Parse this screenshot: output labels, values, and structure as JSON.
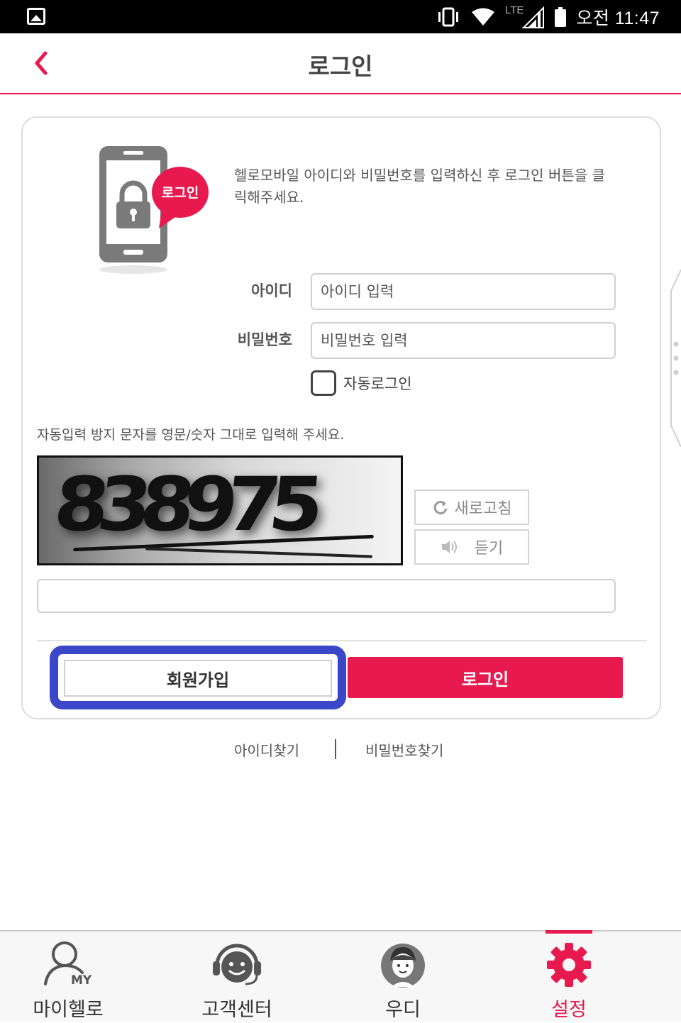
{
  "status_bar": {
    "time": "오전 11:47",
    "network": "LTE"
  },
  "header": {
    "title": "로그인"
  },
  "login": {
    "illustration_badge": "로그인",
    "intro": "헬로모바일 아이디와 비밀번호를 입력하신 후 로그인 버튼을 클릭해주세요.",
    "id_label": "아이디",
    "id_placeholder": "아이디 입력",
    "pw_label": "비밀번호",
    "pw_placeholder": "비밀번호 입력",
    "auto_login_label": "자동로그인",
    "captcha_guide": "자동입력 방지 문자를 영문/숫자 그대로 입력해 주세요.",
    "captcha_code": "838975",
    "refresh_label": "새로고침",
    "listen_label": "듣기",
    "join_label": "회원가입",
    "login_label": "로그인"
  },
  "find_links": {
    "find_id": "아이디찾기",
    "find_pw": "비밀번호찾기"
  },
  "bottom_nav": {
    "items": [
      {
        "label": "마이헬로",
        "icon": "my-person-icon",
        "badge": "MY"
      },
      {
        "label": "고객센터",
        "icon": "headset-icon"
      },
      {
        "label": "우디",
        "icon": "udi-avatar-icon"
      },
      {
        "label": "설정",
        "icon": "gear-icon",
        "active": true
      }
    ]
  },
  "colors": {
    "accent": "#e8194f",
    "highlight": "#3a47c8"
  }
}
